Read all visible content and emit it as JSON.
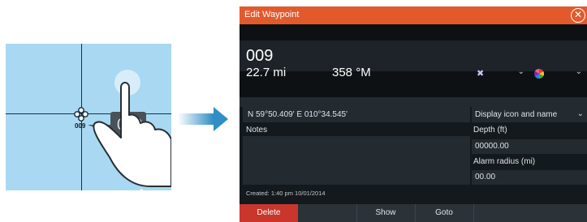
{
  "illustration": {
    "bubble_label": "009",
    "marker_label": "009",
    "tap_count": "x1"
  },
  "dialog": {
    "title": "Edit Waypoint",
    "close_icon": "close-circle-icon",
    "name": "009",
    "distance": "22.7 mi",
    "bearing": "358 °M",
    "position": "N 59°50.409'   E 010°34.545'",
    "display_mode": "Display icon and name",
    "notes_label": "Notes",
    "depth_label": "Depth (ft)",
    "depth_value": "00000.00",
    "alarm_label": "Alarm radius (mi)",
    "alarm_value": "00.00",
    "created": "Created: 1:40 pm  10/01/2014",
    "buttons": {
      "delete": "Delete",
      "show": "Show",
      "goto": "Goto"
    },
    "colors": {
      "title_bar": "#e25a2c",
      "delete_button": "#c9362c",
      "background": "#14191d"
    }
  }
}
